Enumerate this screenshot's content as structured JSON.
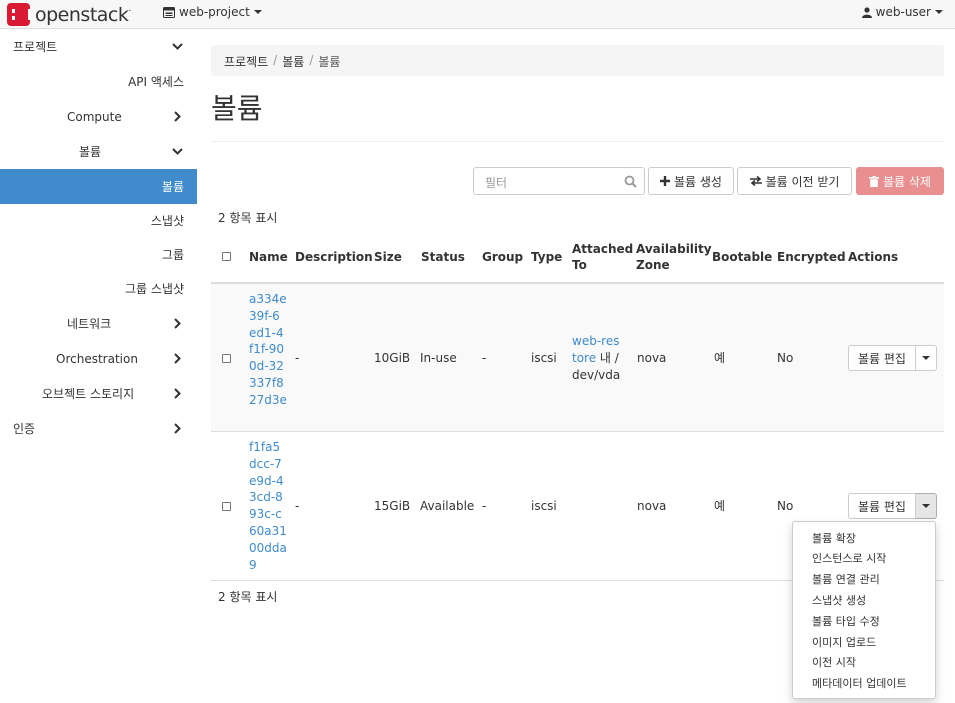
{
  "topbar": {
    "brand": "openstack",
    "brand_mark": ".",
    "project": "web-project",
    "user": "web-user"
  },
  "sidebar": {
    "items": [
      {
        "label": "프로젝트",
        "chevron": "down"
      },
      {
        "label": "API 액세스",
        "chevron": ""
      },
      {
        "label": "Compute",
        "chevron": "right"
      },
      {
        "label": "볼륨",
        "chevron": "down"
      },
      {
        "label": "볼륨",
        "chevron": "",
        "active": true
      },
      {
        "label": "스냅샷",
        "chevron": ""
      },
      {
        "label": "그룹",
        "chevron": ""
      },
      {
        "label": "그룹 스냅샷",
        "chevron": ""
      },
      {
        "label": "네트워크",
        "chevron": "right"
      },
      {
        "label": "Orchestration",
        "chevron": "right"
      },
      {
        "label": "오브젝트 스토리지",
        "chevron": "right"
      },
      {
        "label": "인증",
        "chevron": "right"
      }
    ]
  },
  "breadcrumb": [
    "프로젝트",
    "볼륨",
    "볼륨"
  ],
  "page_title": "볼륨",
  "toolbar": {
    "filter_placeholder": "필터",
    "create_label": "볼륨 생성",
    "transfer_label": "볼륨 이전 받기",
    "delete_label": "볼륨 삭제"
  },
  "count_label": "2 항목 표시",
  "table": {
    "headers": {
      "name": "Name",
      "description": "Description",
      "size": "Size",
      "status": "Status",
      "group": "Group",
      "type": "Type",
      "attached_to": "Attached To",
      "availability_zone": "Availability Zone",
      "bootable": "Bootable",
      "encrypted": "Encrypted",
      "actions": "Actions"
    },
    "rows": [
      {
        "name": "a334e39f-6ed1-4f1f-900d-32337f827d3e",
        "description": "-",
        "size": "10GiB",
        "status": "In-use",
        "group": "-",
        "type": "iscsi",
        "attached_link": "web-restore",
        "attached_rest": " 내 /dev/vda",
        "availability_zone": "nova",
        "bootable": "예",
        "encrypted": "No",
        "action_label": "볼륨 편집"
      },
      {
        "name": "f1fa5dcc-7e9d-43cd-893c-c60a3100dda9",
        "description": "-",
        "size": "15GiB",
        "status": "Available",
        "group": "-",
        "type": "iscsi",
        "attached_link": "",
        "attached_rest": "",
        "availability_zone": "nova",
        "bootable": "예",
        "encrypted": "No",
        "action_label": "볼륨 편집"
      }
    ]
  },
  "action_menu": [
    "볼륨 확장",
    "인스턴스로 시작",
    "볼륨 연결 관리",
    "스냅샷 생성",
    "볼륨 타입 수정",
    "이미지 업로드",
    "이전 시작",
    "메타데이터 업데이트"
  ],
  "colors": {
    "accent": "#3f8bcb",
    "danger": "#e98f8f",
    "brand": "#da1a32"
  },
  "icons": {
    "brand": "openstack-logo-icon",
    "project": "project-icon",
    "user": "user-icon",
    "search": "search-icon",
    "create": "plus-icon",
    "transfer": "transfer-icon",
    "delete": "trash-icon"
  }
}
